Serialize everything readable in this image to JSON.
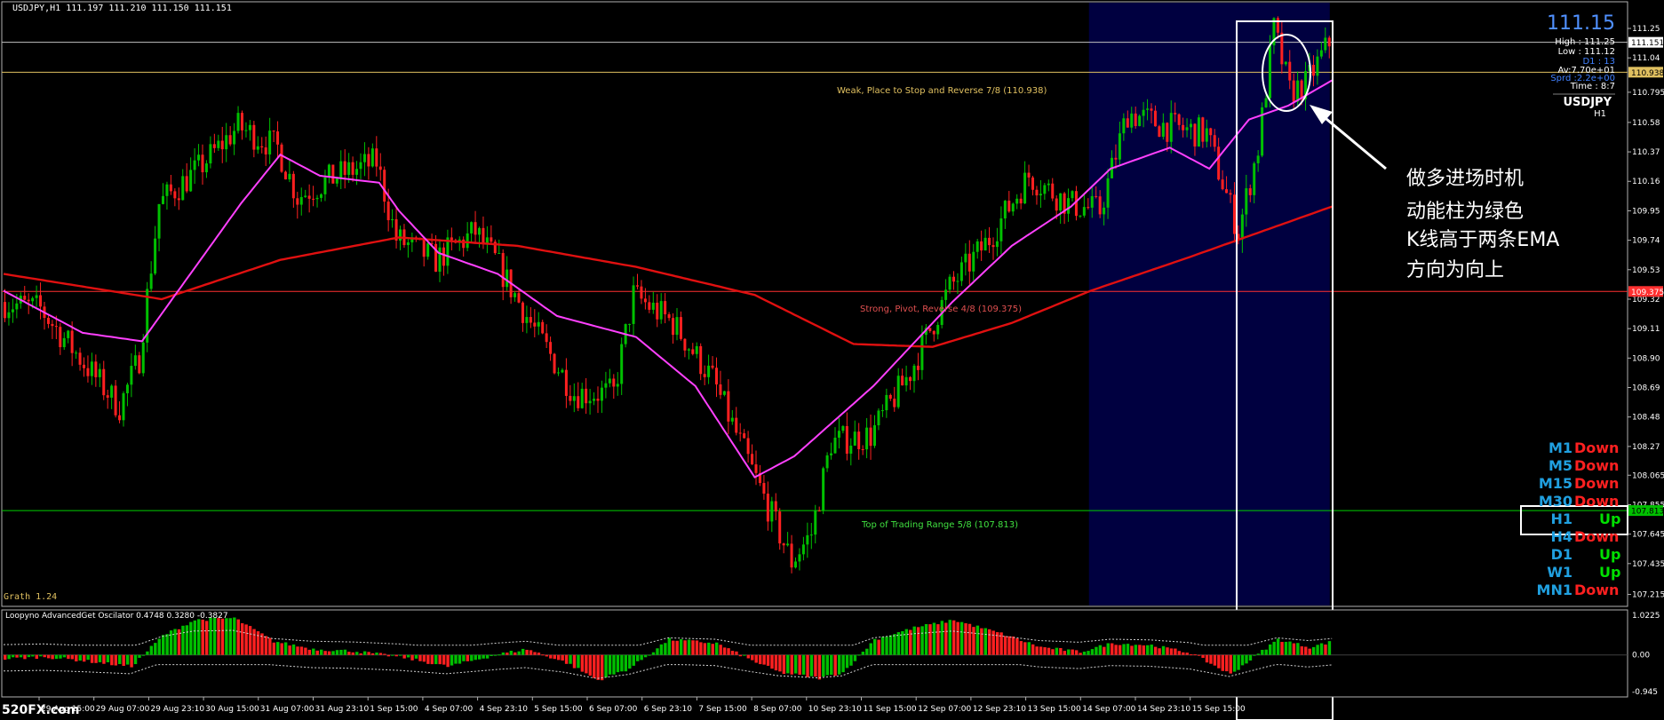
{
  "header": {
    "symbol_line": "USDJPY,H1  111.197 111.210 111.150 111.151"
  },
  "info_panel": {
    "price_big": "111.15",
    "high": "High : 111.25",
    "low": "Low : 111.12",
    "d1": "D1 :   13",
    "av": "Av:7.70e+01",
    "spread": "Sprd :2.2e+00",
    "time": "Time :   8:7",
    "symbol": "USDJPY",
    "timeframe": "H1"
  },
  "levels": {
    "weak": "Weak, Place to Stop and Reverse  7/8  (110.938)",
    "strong": "Strong, Pivot, Reverse  4/8  (109.375)",
    "top": "Top of Trading Range  5/8  (107.813)"
  },
  "price_tags": {
    "current": "111.151",
    "weak": "110.938",
    "strong": "109.375",
    "top": "107.813"
  },
  "indicator_name": "Grath 1.24",
  "oscillator": {
    "title": "Loopyno AdvancedGet Oscilator 0.4748 0.3280 -0.3827",
    "scale": [
      "1.0225",
      "0.00",
      "-0.945"
    ]
  },
  "watermark": "520FX.com",
  "annotation": [
    "做多进场时机",
    "动能柱为绿色",
    "K线高于两条EMA",
    "方向为向上"
  ],
  "trend_table": [
    {
      "tf": "M1",
      "dir": "Down"
    },
    {
      "tf": "M5",
      "dir": "Down"
    },
    {
      "tf": "M15",
      "dir": "Down"
    },
    {
      "tf": "M30",
      "dir": "Down"
    },
    {
      "tf": "H1",
      "dir": "Up"
    },
    {
      "tf": "H4",
      "dir": "Down"
    },
    {
      "tf": "D1",
      "dir": "Up"
    },
    {
      "tf": "W1",
      "dir": "Up"
    },
    {
      "tf": "MN1",
      "dir": "Down"
    }
  ],
  "colors": {
    "bull": "#00c000",
    "bear": "#ff2020",
    "ema_fast": "#ff40ff",
    "ema_slow": "#e01010",
    "highlight": "#000040",
    "tf_label": "#20a0e0",
    "up": "#00e000",
    "down": "#ff2020"
  },
  "chart_data": {
    "type": "candlestick",
    "symbol": "USDJPY",
    "timeframe": "H1",
    "x_ticks": [
      "29 Aug 15:00",
      "29 Aug 07:00",
      "29 Aug 23:10",
      "30 Aug 15:00",
      "31 Aug 07:00",
      "31 Aug 23:10",
      "1 Sep 15:00",
      "4 Sep 07:00",
      "4 Sep 23:10",
      "5 Sep 15:00",
      "6 Sep 07:00",
      "6 Sep 23:10",
      "7 Sep 15:00",
      "8 Sep 07:00",
      "10 Sep 23:10",
      "11 Sep 15:00",
      "12 Sep 07:00",
      "12 Sep 23:10",
      "13 Sep 15:00",
      "14 Sep 07:00",
      "14 Sep 23:10",
      "15 Sep 15:00"
    ],
    "y_ticks": [
      111.25,
      111.04,
      110.795,
      110.58,
      110.37,
      110.16,
      109.95,
      109.74,
      109.53,
      109.32,
      109.11,
      108.9,
      108.69,
      108.48,
      108.27,
      108.065,
      107.855,
      107.645,
      107.435,
      107.215
    ],
    "ylim": [
      107.13,
      111.44
    ],
    "horizontal_levels": [
      {
        "value": 111.151,
        "color": "#c0c0c0"
      },
      {
        "value": 110.938,
        "color": "#e0c060"
      },
      {
        "value": 109.375,
        "color": "#ff3030"
      },
      {
        "value": 107.813,
        "color": "#00d000"
      }
    ],
    "ema_fast_anchors": [
      [
        0,
        109.38
      ],
      [
        20,
        109.08
      ],
      [
        35,
        109.02
      ],
      [
        60,
        110.0
      ],
      [
        70,
        110.35
      ],
      [
        80,
        110.2
      ],
      [
        95,
        110.15
      ],
      [
        100,
        109.95
      ],
      [
        110,
        109.65
      ],
      [
        125,
        109.5
      ],
      [
        140,
        109.2
      ],
      [
        160,
        109.05
      ],
      [
        175,
        108.7
      ],
      [
        190,
        108.05
      ],
      [
        200,
        108.2
      ],
      [
        220,
        108.7
      ],
      [
        240,
        109.3
      ],
      [
        255,
        109.7
      ],
      [
        270,
        109.98
      ],
      [
        280,
        110.25
      ],
      [
        295,
        110.4
      ],
      [
        305,
        110.25
      ],
      [
        315,
        110.6
      ],
      [
        325,
        110.7
      ],
      [
        336,
        110.88
      ]
    ],
    "ema_slow_anchors": [
      [
        0,
        109.5
      ],
      [
        40,
        109.32
      ],
      [
        70,
        109.6
      ],
      [
        100,
        109.76
      ],
      [
        130,
        109.7
      ],
      [
        160,
        109.55
      ],
      [
        190,
        109.35
      ],
      [
        215,
        109.0
      ],
      [
        235,
        108.98
      ],
      [
        255,
        109.15
      ],
      [
        275,
        109.38
      ],
      [
        300,
        109.62
      ],
      [
        320,
        109.82
      ],
      [
        336,
        109.98
      ]
    ],
    "price_anchors": [
      [
        0,
        109.3
      ],
      [
        10,
        109.25
      ],
      [
        20,
        108.9
      ],
      [
        30,
        108.55
      ],
      [
        35,
        108.9
      ],
      [
        40,
        110.0
      ],
      [
        50,
        110.25
      ],
      [
        60,
        110.55
      ],
      [
        70,
        110.4
      ],
      [
        75,
        110.05
      ],
      [
        85,
        110.2
      ],
      [
        95,
        110.3
      ],
      [
        100,
        109.75
      ],
      [
        110,
        109.6
      ],
      [
        120,
        109.8
      ],
      [
        125,
        109.6
      ],
      [
        135,
        109.1
      ],
      [
        145,
        108.65
      ],
      [
        155,
        108.65
      ],
      [
        160,
        109.35
      ],
      [
        170,
        109.15
      ],
      [
        180,
        108.75
      ],
      [
        190,
        108.1
      ],
      [
        200,
        107.45
      ],
      [
        205,
        107.65
      ],
      [
        210,
        108.3
      ],
      [
        220,
        108.35
      ],
      [
        230,
        108.8
      ],
      [
        240,
        109.4
      ],
      [
        250,
        109.75
      ],
      [
        260,
        110.2
      ],
      [
        270,
        110.0
      ],
      [
        278,
        109.95
      ],
      [
        285,
        110.65
      ],
      [
        295,
        110.55
      ],
      [
        305,
        110.5
      ],
      [
        313,
        109.8
      ],
      [
        318,
        110.4
      ],
      [
        322,
        111.25
      ],
      [
        326,
        110.8
      ],
      [
        330,
        110.85
      ],
      [
        336,
        111.15
      ]
    ],
    "highlight_range": [
      275,
      335
    ],
    "oscillator": {
      "ylim": [
        -0.945,
        1.0225
      ],
      "anchors": [
        [
          0,
          -0.1
        ],
        [
          10,
          -0.05
        ],
        [
          20,
          -0.15
        ],
        [
          32,
          -0.3
        ],
        [
          40,
          0.5
        ],
        [
          48,
          0.9
        ],
        [
          58,
          0.95
        ],
        [
          68,
          0.35
        ],
        [
          78,
          0.15
        ],
        [
          88,
          0.1
        ],
        [
          100,
          -0.05
        ],
        [
          112,
          -0.3
        ],
        [
          125,
          0.02
        ],
        [
          132,
          0.15
        ],
        [
          142,
          -0.2
        ],
        [
          150,
          -0.65
        ],
        [
          158,
          -0.35
        ],
        [
          168,
          0.4
        ],
        [
          180,
          0.3
        ],
        [
          188,
          -0.1
        ],
        [
          196,
          -0.45
        ],
        [
          206,
          -0.6
        ],
        [
          212,
          -0.45
        ],
        [
          220,
          0.4
        ],
        [
          230,
          0.7
        ],
        [
          240,
          0.9
        ],
        [
          252,
          0.55
        ],
        [
          262,
          0.2
        ],
        [
          272,
          0.08
        ],
        [
          280,
          0.3
        ],
        [
          290,
          0.25
        ],
        [
          300,
          0.05
        ],
        [
          310,
          -0.5
        ],
        [
          318,
          0.1
        ],
        [
          322,
          0.4
        ],
        [
          330,
          0.2
        ],
        [
          336,
          0.35
        ]
      ]
    }
  }
}
